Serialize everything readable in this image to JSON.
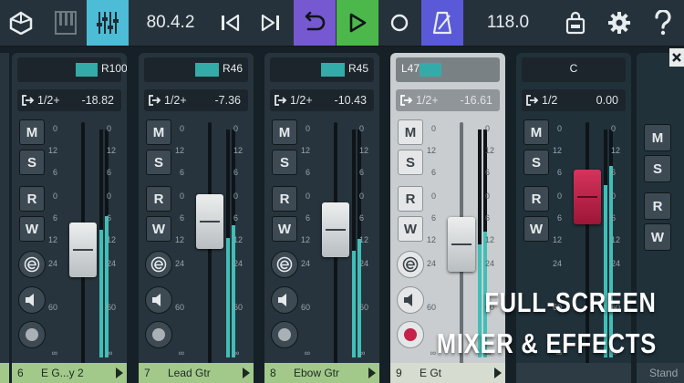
{
  "toolbar": {
    "position": "80.4.2",
    "tempo": "118.0",
    "colors": {
      "active_mixer": "#4dbcd6",
      "loop": "#7658d0",
      "play": "#4cb84b",
      "metronome": "#5a5ad8"
    }
  },
  "strips": [
    {
      "pan": "R100",
      "io": "1/2+",
      "level": "-18.82",
      "ticks": [
        "0",
        "12",
        "6",
        "0",
        "6",
        "12",
        "24",
        "60",
        "∞"
      ],
      "m": "M",
      "s": "S",
      "r": "R",
      "w": "W",
      "num": "6",
      "name": "E G...y 2",
      "meter": 0.62
    },
    {
      "pan": "R46",
      "io": "1/2+",
      "level": "-7.36",
      "ticks": [
        "0",
        "12",
        "6",
        "0",
        "6",
        "12",
        "24",
        "60",
        "∞"
      ],
      "m": "M",
      "s": "S",
      "r": "R",
      "w": "W",
      "num": "7",
      "name": "Lead Gtr",
      "meter": 0.58
    },
    {
      "pan": "R45",
      "io": "1/2+",
      "level": "-10.43",
      "ticks": [
        "0",
        "12",
        "6",
        "0",
        "6",
        "12",
        "24",
        "60",
        "∞"
      ],
      "m": "M",
      "s": "S",
      "r": "R",
      "w": "W",
      "num": "8",
      "name": "Ebow Gtr",
      "meter": 0.52
    },
    {
      "pan": "L47",
      "io": "1/2+",
      "level": "-16.61",
      "ticks": [
        "0",
        "12",
        "6",
        "0",
        "6",
        "12",
        "24",
        "60",
        "∞"
      ],
      "m": "M",
      "s": "S",
      "r": "R",
      "w": "W",
      "num": "9",
      "name": "E Gt",
      "meter": 0.55
    },
    {
      "pan": "C",
      "io": "1/2",
      "level": "0.00",
      "ticks": [
        "0",
        "12",
        "6",
        "0",
        "6",
        "12",
        "24",
        "60",
        "∞"
      ],
      "m": "M",
      "s": "S",
      "r": "R",
      "w": "W",
      "num": "",
      "name": "",
      "meter": 0.84
    }
  ],
  "partial_strip": {
    "m": "M",
    "s": "S",
    "r": "R",
    "w": "W",
    "name": "Stand"
  },
  "overlay": {
    "line1": "FULL-SCREEN",
    "line2": "MIXER & EFFECTS"
  }
}
